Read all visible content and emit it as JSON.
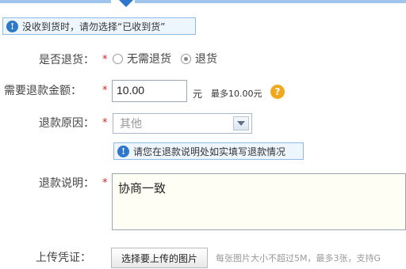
{
  "notice": {
    "icon": "info-icon",
    "text": "没收到货时，请勿选择“已收到货”"
  },
  "form": {
    "return_goods": {
      "label": "是否退货：",
      "required_mark": "*",
      "options": [
        {
          "label": "无需退货",
          "checked": false
        },
        {
          "label": "退货",
          "checked": true
        }
      ]
    },
    "refund_amount": {
      "label": "需要退款金额：",
      "required_mark": "*",
      "value": "10.00",
      "unit": "元",
      "max_text": "最多10.00元",
      "help_icon": "question-icon",
      "help_symbol": "?"
    },
    "refund_reason": {
      "label": "退款原因：",
      "required_mark": "*",
      "selected": "其他",
      "tip": "请您在退款说明处如实填写退款情况",
      "tip_icon": "info-icon"
    },
    "refund_note": {
      "label": "退款说明：",
      "required_mark": "*",
      "value": "协商一致"
    },
    "upload": {
      "label": "上传凭证：",
      "button_label": "选择要上传的图片",
      "hint": "每张图片大小不超过5M，最多3张，支持G"
    }
  },
  "colors": {
    "accent_blue": "#2f77c8",
    "tip_background": "#eef6fd",
    "tip_border": "#8dbbe5",
    "required_red": "#e02020",
    "help_orange": "#f2a81c",
    "textarea_background": "#fffef4"
  }
}
